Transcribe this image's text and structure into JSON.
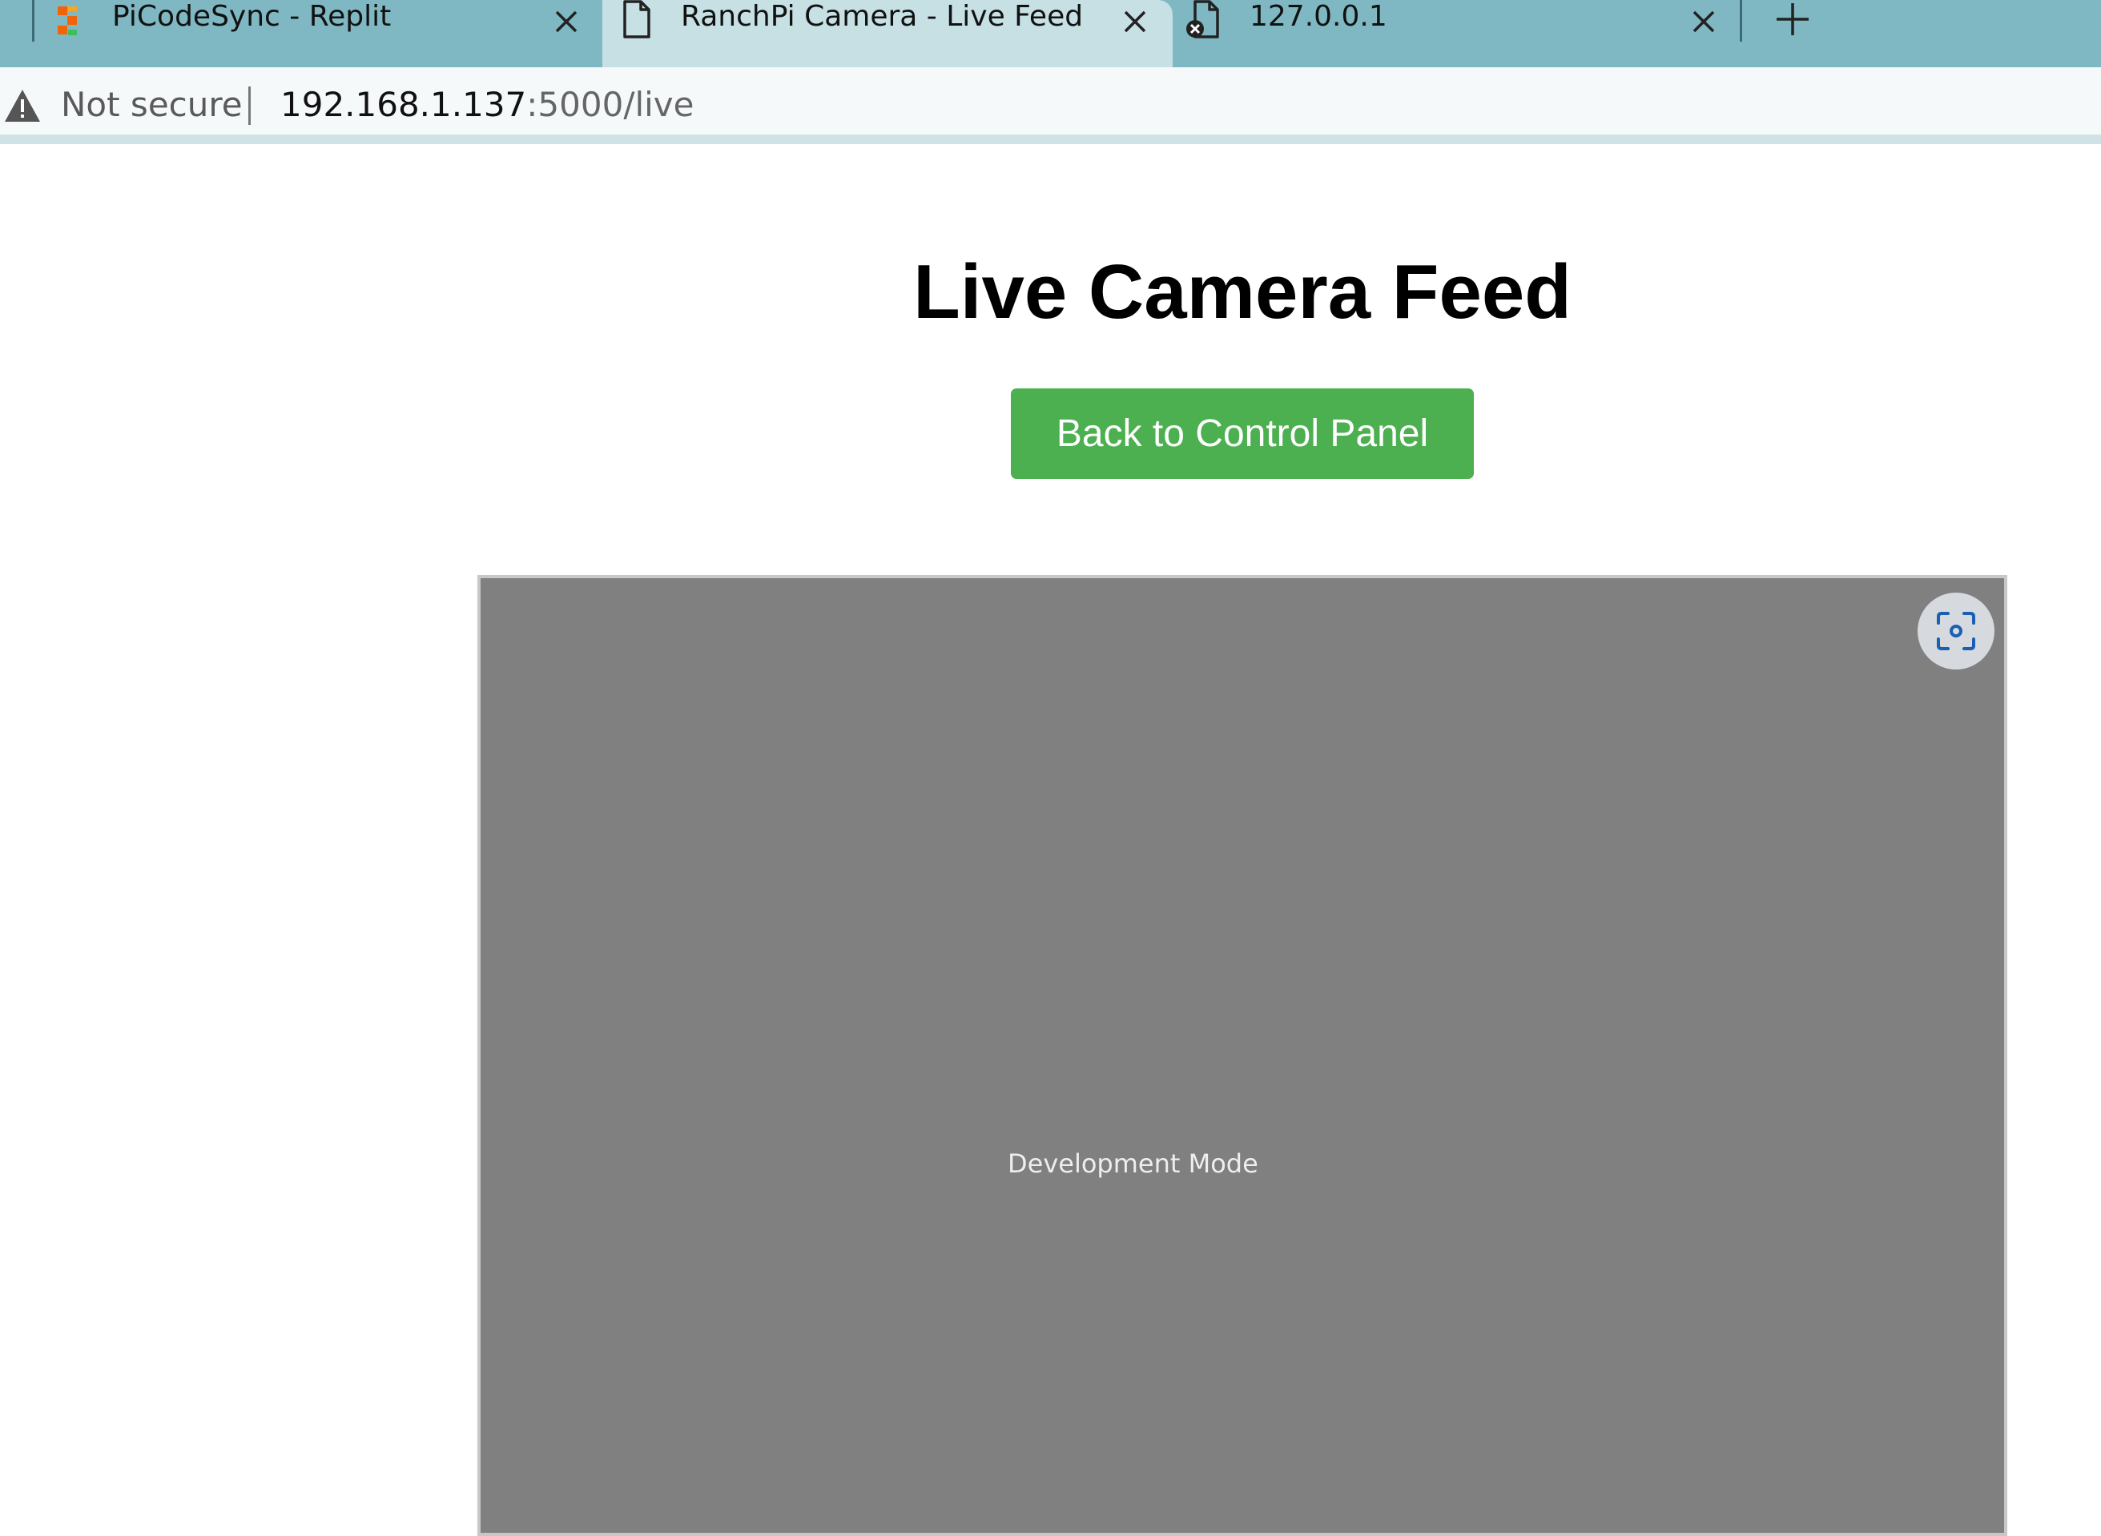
{
  "browser": {
    "tabs": [
      {
        "title": "PiCodeSync - Replit",
        "icon": "replit-logo-icon",
        "active": false
      },
      {
        "title": "RanchPi Camera - Live Feed",
        "icon": "document-icon",
        "active": true
      },
      {
        "title": "127.0.0.1",
        "icon": "document-error-icon",
        "active": false
      }
    ],
    "new_tab_icon": "plus-icon",
    "address_bar": {
      "security_label": "Not secure",
      "url_host": "192.168.1.137",
      "url_path": ":5000/live"
    }
  },
  "page": {
    "title": "Live Camera Feed",
    "back_button_label": "Back to Control Panel",
    "feed": {
      "placeholder_text": "Development Mode",
      "lens_icon": "visual-search-icon"
    }
  },
  "colors": {
    "tab_strip": "#7fb8c2",
    "active_tab": "#c6e0e4",
    "button_green": "#4caf50",
    "feed_gray": "#808080"
  }
}
